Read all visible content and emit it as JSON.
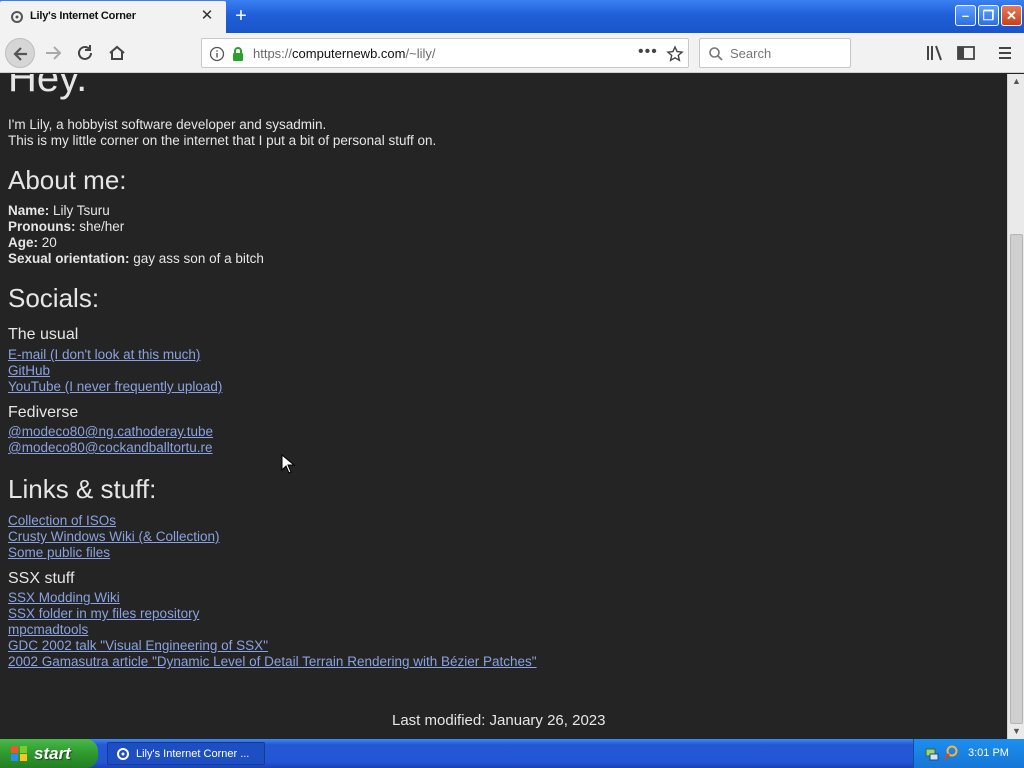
{
  "browser": {
    "tab_title": "Lily's Internet Corner",
    "url_prefix": "https://",
    "url_domain": "computernewb.com",
    "url_path": "/~lily/",
    "search_placeholder": "Search"
  },
  "page": {
    "heading": "Hey.",
    "intro_line1": "I'm Lily, a hobbyist software developer and sysadmin.",
    "intro_line2": "This is my little corner on the internet that I put a bit of personal stuff on.",
    "about_heading": "About me:",
    "about": [
      {
        "label": "Name:",
        "value": " Lily Tsuru"
      },
      {
        "label": "Pronouns:",
        "value": " she/her"
      },
      {
        "label": "Age:",
        "value": " 20"
      },
      {
        "label": "Sexual orientation:",
        "value": " gay ass son of a bitch"
      }
    ],
    "socials_heading": "Socials:",
    "usual_heading": "The usual",
    "usual_links": [
      "E-mail (I don't look at this much)",
      "GitHub",
      "YouTube (I never frequently upload)"
    ],
    "fediverse_heading": "Fediverse",
    "fediverse_links": [
      "@modeco80@ng.cathoderay.tube",
      "@modeco80@cockandballtortu.re"
    ],
    "links_heading": "Links & stuff:",
    "links": [
      "Collection of ISOs",
      "Crusty Windows Wiki (& Collection)",
      "Some public files"
    ],
    "ssx_heading": "SSX stuff",
    "ssx_links": [
      "SSX Modding Wiki",
      "SSX folder in my files repository",
      "mpcmadtools",
      "GDC 2002 talk \"Visual Engineering of SSX\"",
      "2002 Gamasutra article \"Dynamic Level of Detail Terrain Rendering with Bézier Patches\""
    ],
    "last_modified": "Last modified: January 26, 2023"
  },
  "taskbar": {
    "start_label": "start",
    "task_label": "Lily's Internet Corner ...",
    "clock": "3:01 PM"
  },
  "colors": {
    "page_bg": "#242424",
    "text": "#e6e6e6",
    "link": "#8aa2e0"
  }
}
